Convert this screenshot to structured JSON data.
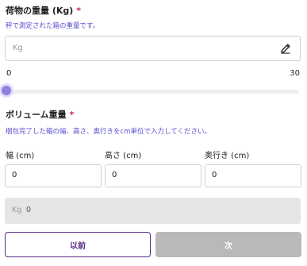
{
  "weight": {
    "title": "荷物の重量 (Kg)",
    "required_mark": "*",
    "hint": "秤で測定された箱の重量です。",
    "placeholder": "Kg",
    "icon": "pencil-icon",
    "range_min": "0",
    "range_max": "30",
    "slider_value": 0
  },
  "volume": {
    "title": "ボリューム重量",
    "required_mark": "*",
    "hint": "梱包完了した箱の幅、高さ、奥行きをcm単位で入力してください。",
    "width_label": "幅 (cm)",
    "width_value": "0",
    "height_label": "高さ (cm)",
    "height_value": "0",
    "depth_label": "奥行き (cm)",
    "depth_value": "0",
    "result_unit": "Kg",
    "result_value": "0"
  },
  "actions": {
    "prev_label": "以前",
    "next_label": "次"
  },
  "colors": {
    "accent": "#5b2a86",
    "hint": "#5a4fcf",
    "required": "#d6244f",
    "slider_thumb": "#8e7fe0",
    "disabled_button": "#b9b9b9"
  }
}
